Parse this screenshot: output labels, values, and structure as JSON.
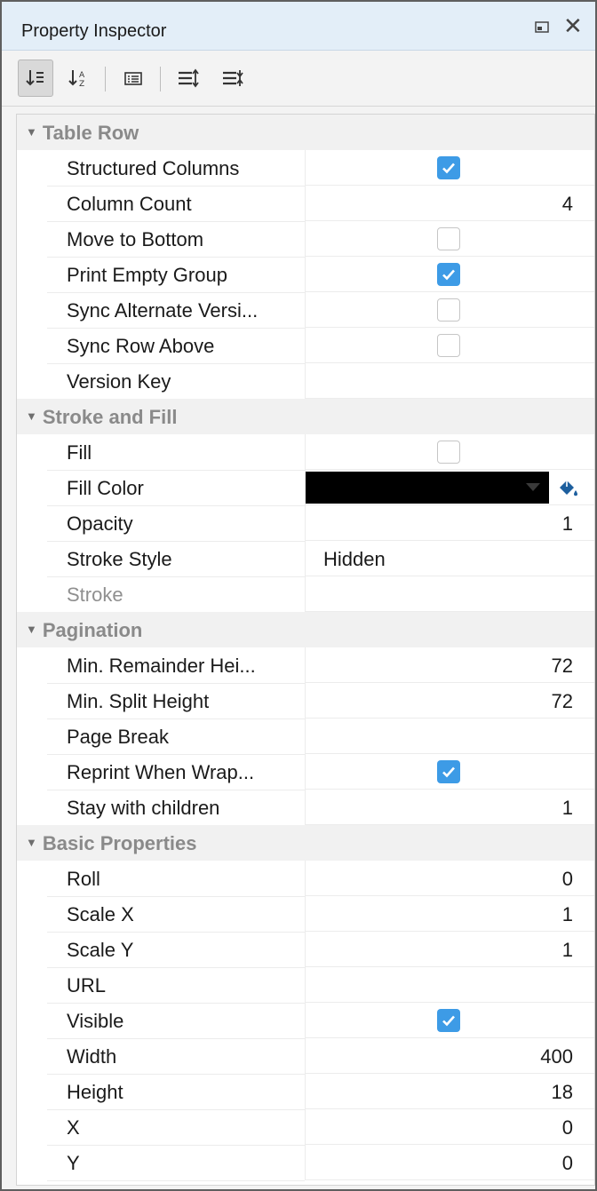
{
  "title": "Property Inspector",
  "colors": {
    "checkbox_checked": "#3d9be6",
    "fill_color_value": "#000000",
    "group_text": "#8a8a8a",
    "title_bar": "#e3eef8"
  },
  "toolbar": {
    "icons": [
      "sort-categorized-icon",
      "sort-alphabetical-icon",
      "description-icon",
      "expand-all-icon",
      "collapse-all-icon"
    ],
    "active": "sort-categorized-icon"
  },
  "groups": {
    "table_row": "Table Row",
    "stroke_fill": "Stroke and Fill",
    "pagination": "Pagination",
    "basic": "Basic Properties"
  },
  "props": {
    "structured_columns": {
      "name": "Structured Columns",
      "checked": true
    },
    "column_count": {
      "name": "Column Count",
      "value": "4"
    },
    "move_to_bottom": {
      "name": "Move to Bottom",
      "checked": false
    },
    "print_empty_group": {
      "name": "Print Empty Group",
      "checked": true
    },
    "sync_alternate": {
      "name": "Sync Alternate Versi...",
      "checked": false
    },
    "sync_row_above": {
      "name": "Sync Row Above",
      "checked": false
    },
    "version_key": {
      "name": "Version Key",
      "value": ""
    },
    "fill": {
      "name": "Fill",
      "checked": false
    },
    "fill_color": {
      "name": "Fill Color",
      "value": "#000000"
    },
    "opacity": {
      "name": "Opacity",
      "value": "1"
    },
    "stroke_style": {
      "name": "Stroke Style",
      "value": "Hidden"
    },
    "stroke": {
      "name": "Stroke",
      "value": ""
    },
    "min_remainder": {
      "name": "Min. Remainder Hei...",
      "value": "72"
    },
    "min_split": {
      "name": "Min. Split Height",
      "value": "72"
    },
    "page_break": {
      "name": "Page Break",
      "value": ""
    },
    "reprint_when_wrap": {
      "name": "Reprint When Wrap...",
      "checked": true
    },
    "stay_with_children": {
      "name": "Stay with children",
      "value": "1"
    },
    "roll": {
      "name": "Roll",
      "value": "0"
    },
    "scale_x": {
      "name": "Scale X",
      "value": "1"
    },
    "scale_y": {
      "name": "Scale Y",
      "value": "1"
    },
    "url": {
      "name": "URL",
      "value": ""
    },
    "visible": {
      "name": "Visible",
      "checked": true
    },
    "width": {
      "name": "Width",
      "value": "400"
    },
    "height": {
      "name": "Height",
      "value": "18"
    },
    "x": {
      "name": "X",
      "value": "0"
    },
    "y": {
      "name": "Y",
      "value": "0"
    }
  }
}
